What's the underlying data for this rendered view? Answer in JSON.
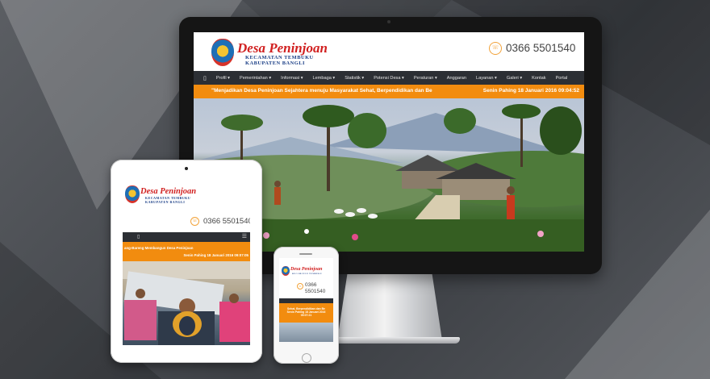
{
  "site": {
    "title": "Desa Peninjoan",
    "subtitle_line1": "KECAMATAN TEMBUKU",
    "subtitle_line2": "KABUPATEN BANGLI",
    "phone": "0366 5501540",
    "phone_icon": "phone-icon"
  },
  "nav": {
    "home_icon": "▯",
    "items": [
      "Profil ▾",
      "Pemerintahan ▾",
      "Informasi ▾",
      "Lembaga ▾",
      "Statistik ▾",
      "Potensi Desa ▾",
      "Peraturan ▾",
      "Anggaran",
      "Layanan ▾",
      "Galeri ▾",
      "Kontak",
      "Portal"
    ]
  },
  "ticker": {
    "desktop_message": "\"Menjadikan Desa Peninjoan Sejahtera menuju Masyarakat Sehat, Berpendidikan dan Be",
    "date": "Senin Pahing 18 Januari 2016 09:04:52",
    "tablet_message": "ang-Bareng Membangun Desa Peninjoan",
    "tablet_date": "Senin Pahing 18 Januari 2016 09:07:05",
    "phone_message_line1": "Sehat, Berpendidikan dan Be",
    "phone_message_line2": "Senin Pahing 18 Januari 2016",
    "phone_message_line3": "09:07:21"
  },
  "tablet": {
    "phone": "0366 5501540",
    "nav_icon": "▯",
    "menu_icon": "☰"
  },
  "mobile": {
    "phone_line1": "0366",
    "phone_line2": "5501540"
  },
  "colors": {
    "accent_orange": "#f28c0f",
    "nav_dark": "#2c2f34",
    "title_red": "#d12020",
    "subtitle_blue": "#1a3e86"
  }
}
